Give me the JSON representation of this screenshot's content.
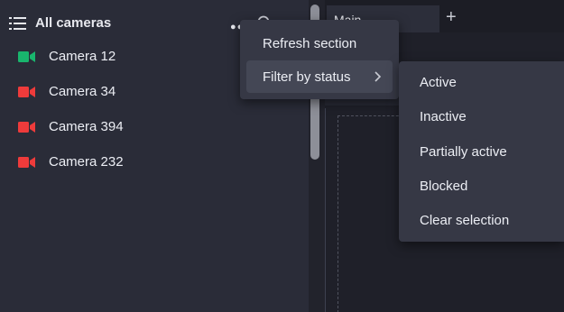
{
  "left_panel": {
    "title": "All cameras",
    "cameras": [
      {
        "label": "Camera 12",
        "status_color": "#19b56d"
      },
      {
        "label": "Camera 34",
        "status_color": "#ee3b3b"
      },
      {
        "label": "Camera 394",
        "status_color": "#ee3b3b"
      },
      {
        "label": "Camera 232",
        "status_color": "#ee3b3b"
      }
    ]
  },
  "tabs": {
    "main_label": "Main",
    "add_label": "+"
  },
  "context_menu": {
    "items": [
      {
        "label": "Refresh section"
      },
      {
        "label": "Filter by status"
      }
    ]
  },
  "status_submenu": {
    "items": [
      {
        "label": "Active"
      },
      {
        "label": "Inactive"
      },
      {
        "label": "Partially active"
      },
      {
        "label": "Blocked"
      },
      {
        "label": "Clear selection"
      }
    ]
  },
  "colors": {
    "active_camera": "#19b56d",
    "inactive_camera": "#ee3b3b",
    "menu_background": "#363845",
    "menu_highlight": "#444755"
  },
  "icons": [
    "list-icon",
    "more-icon",
    "search-icon",
    "camera-icon",
    "chevron-right-icon",
    "plus-icon"
  ]
}
